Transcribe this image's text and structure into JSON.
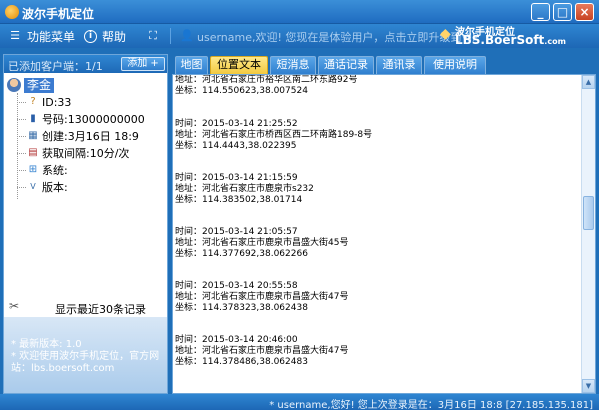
{
  "window": {
    "title": "波尔手机定位",
    "min_label": "_",
    "max_label": "□",
    "close_label": "×"
  },
  "toolbar": {
    "menu_label": "功能菜单",
    "help_label": "帮助",
    "user_text": "username,欢迎! 您现在是体验用户，点击立即升级到VIP",
    "brand_cn": "波尔手机定位",
    "brand_en": "LBS.BoerSoft",
    "brand_suffix": ".com"
  },
  "sidebar": {
    "customer_count": "已添加客户端：1/1",
    "add_label": "添加 +",
    "root_name": "李金",
    "details": [
      {
        "icon": "id-icon",
        "text": "ID:33"
      },
      {
        "icon": "phone-icon",
        "text": "号码:13000000000"
      },
      {
        "icon": "calendar-icon",
        "text": "创建:3月16日 18:9"
      },
      {
        "icon": "interval-icon",
        "text": "获取间隔:10分/次"
      },
      {
        "icon": "windows-icon",
        "text": "系统:"
      },
      {
        "icon": "version-icon",
        "text": "版本:"
      }
    ],
    "show_recent_label": "显示最近30条记录",
    "footer": [
      "* 最新版本: 1.0",
      "* 欢迎使用波尔手机定位，官方网",
      "站：lbs.boersoft.com"
    ]
  },
  "tabs": [
    {
      "label": "地图",
      "active": false
    },
    {
      "label": "位置文本",
      "active": true
    },
    {
      "label": "短消息",
      "active": false
    },
    {
      "label": "通话记录",
      "active": false
    },
    {
      "label": "通讯录",
      "active": false
    },
    {
      "label": "使用说明",
      "active": false
    }
  ],
  "log": [
    {
      "addr": "地址：河北省石家庄市裕华区南二环东路92号",
      "coord": "坐标：114.550623,38.007524"
    },
    {
      "time": "时间：2015-03-14 21:25:52",
      "addr": "地址：河北省石家庄市桥西区西二环南路189-8号",
      "coord": "坐标：114.4443,38.022395"
    },
    {
      "time": "时间：2015-03-14 21:15:59",
      "addr": "地址：河北省石家庄市鹿泉市s232",
      "coord": "坐标：114.383502,38.01714"
    },
    {
      "time": "时间：2015-03-14 21:05:57",
      "addr": "地址：河北省石家庄市鹿泉市昌盛大街45号",
      "coord": "坐标：114.377692,38.062266"
    },
    {
      "time": "时间：2015-03-14 20:55:58",
      "addr": "地址：河北省石家庄市鹿泉市昌盛大街47号",
      "coord": "坐标：114.378323,38.062438"
    },
    {
      "time": "时间：2015-03-14 20:46:00",
      "addr": "地址：河北省石家庄市鹿泉市昌盛大街47号",
      "coord": "坐标：114.378486,38.062483"
    }
  ],
  "status": {
    "text": "* username,您好! 您上次登录是在：3月16日 18:8  [27.185.135.181]"
  }
}
